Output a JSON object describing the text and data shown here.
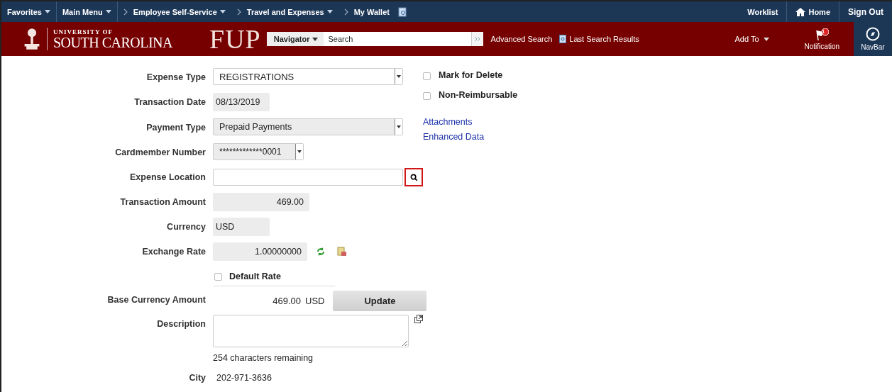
{
  "top_nav": {
    "menus": [
      {
        "label": "Favorites",
        "dropdown": true
      },
      {
        "label": "Main Menu",
        "dropdown": true
      }
    ],
    "breadcrumbs": [
      {
        "label": "Employee Self-Service",
        "dropdown": true
      },
      {
        "label": "Travel and Expenses",
        "dropdown": true
      },
      {
        "label": "My Wallet",
        "dropdown": false
      }
    ],
    "right_links": [
      {
        "kind": "text",
        "label": "Worklist"
      },
      {
        "kind": "home",
        "label": "Home"
      },
      {
        "kind": "text",
        "label": "Sign Out"
      }
    ]
  },
  "banner": {
    "logo_small": "UNIVERSITY OF",
    "logo_large": "SOUTH CAROLINA",
    "app_logo": "FUP",
    "search": {
      "menu": "Navigator",
      "placeholder": "Search"
    },
    "links": [
      {
        "kind": "text",
        "label": "Advanced Search"
      },
      {
        "kind": "icon",
        "label": "Last Search Results"
      }
    ],
    "add_to": "Add To",
    "notification": {
      "label": "Notification",
      "badge": "1"
    },
    "navbar": "NavBar"
  },
  "form": {
    "rows": [
      {
        "kind": "select",
        "label": "Expense Type",
        "value": "REGISTRATIONS",
        "disabled": false
      },
      {
        "kind": "display",
        "label": "Transaction Date",
        "value": "08/13/2019"
      },
      {
        "kind": "select",
        "label": "Payment Type",
        "value": "Prepaid Payments",
        "disabled": true
      },
      {
        "kind": "select",
        "label": "Cardmember Number",
        "value": "*************0001",
        "disabled": true
      },
      {
        "kind": "lookup",
        "label": "Expense Location",
        "highlighted": true
      },
      {
        "kind": "amount",
        "label": "Transaction Amount",
        "value": "469.00"
      },
      {
        "kind": "display",
        "label": "Currency",
        "value": "USD"
      },
      {
        "kind": "rate",
        "label": "Exchange Rate",
        "value": "1.00000000"
      },
      {
        "kind": "checkbox",
        "label": "Default Rate",
        "checked": false
      },
      {
        "kind": "base",
        "label": "Base Currency Amount",
        "value": "469.00",
        "currency": "USD",
        "button": "Update"
      },
      {
        "kind": "textarea",
        "label": "Description",
        "hint": "254 characters remaining"
      },
      {
        "kind": "text",
        "label": "City",
        "value": "202-971-3636"
      }
    ]
  },
  "side": {
    "checkboxes": [
      {
        "label": "Mark for Delete",
        "checked": false
      },
      {
        "label": "Non-Reimbursable",
        "checked": false
      }
    ],
    "links": [
      "Attachments",
      "Enhanced Data"
    ]
  }
}
